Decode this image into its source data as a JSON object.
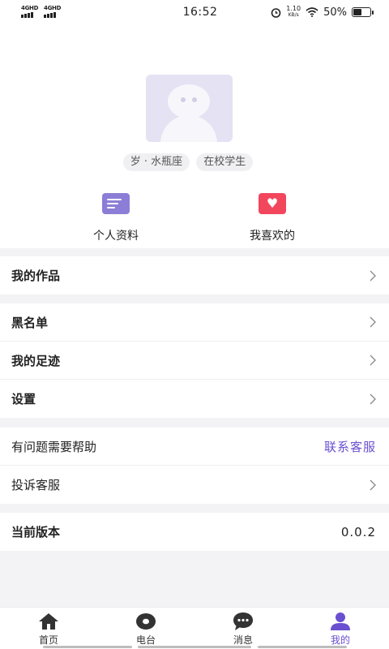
{
  "status": {
    "network_left": "4GHD",
    "network_right": "4GHD",
    "time": "16:52",
    "net_speed_value": "1.10",
    "net_speed_unit": "KB/s",
    "battery": "50%",
    "battery_level": 0.5
  },
  "profile": {
    "tags": [
      "岁 · 水瓶座",
      "在校学生"
    ]
  },
  "shortcuts": {
    "profile_info": "个人资料",
    "favorites": "我喜欢的"
  },
  "menu": {
    "works": "我的作品",
    "blacklist": "黑名单",
    "footprints": "我的足迹",
    "settings": "设置",
    "help": "有问题需要帮助",
    "contact_service": "联系客服",
    "complaint": "投诉客服",
    "version_label": "当前版本",
    "version_value": "0.0.2"
  },
  "tabbar": {
    "home": "首页",
    "radio": "电台",
    "messages": "消息",
    "mine": "我的"
  },
  "colors": {
    "accent": "#6a4fd0",
    "heart": "#f2465d",
    "card": "#8c7ed6"
  }
}
